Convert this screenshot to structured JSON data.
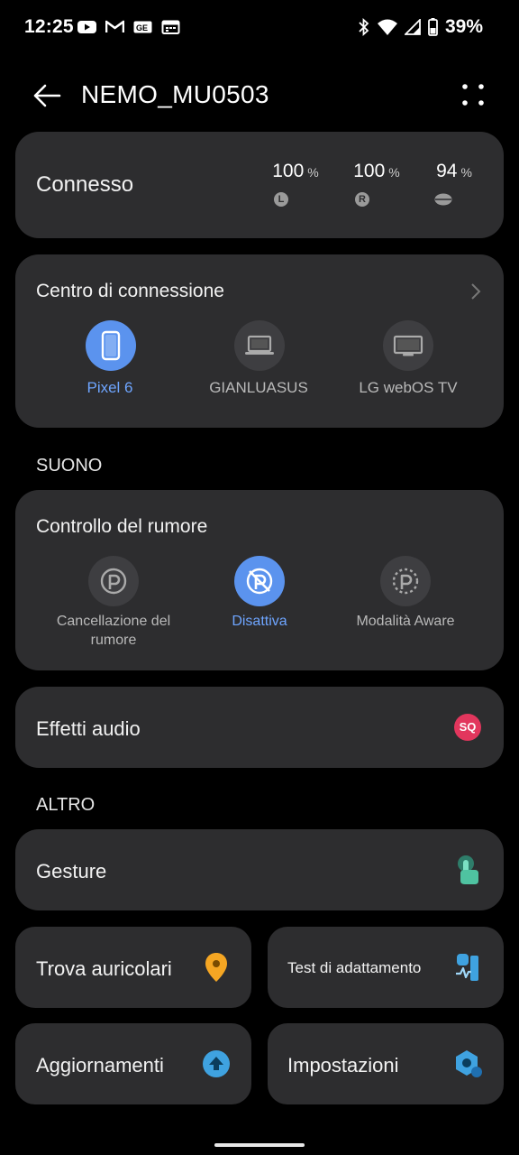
{
  "status_bar": {
    "time": "12:25",
    "battery": "39%",
    "icons": [
      "youtube-icon",
      "gmail-icon",
      "ge-icon",
      "calendar-icon",
      "bluetooth-icon",
      "wifi-icon",
      "signal-icon",
      "battery-icon"
    ]
  },
  "app_bar": {
    "title": "NEMO_MU0503"
  },
  "connection": {
    "label": "Connesso",
    "batteries": [
      {
        "value": "100",
        "unit": "%",
        "badge": "L"
      },
      {
        "value": "100",
        "unit": "%",
        "badge": "R"
      },
      {
        "value": "94",
        "unit": "%",
        "badge": ""
      }
    ]
  },
  "connection_center": {
    "title": "Centro di connessione",
    "devices": [
      {
        "name": "Pixel 6",
        "active": true
      },
      {
        "name": "GIANLUASUS",
        "active": false
      },
      {
        "name": "LG webOS TV",
        "active": false
      }
    ]
  },
  "sections": {
    "sound": "SUONO",
    "other": "ALTRO"
  },
  "noise_control": {
    "title": "Controllo del rumore",
    "modes": [
      {
        "label_line1": "Cancellazione del",
        "label_line2": "rumore",
        "active": false
      },
      {
        "label_line1": "Disattiva",
        "label_line2": "",
        "active": true
      },
      {
        "label_line1": "Modalità Aware",
        "label_line2": "",
        "active": false
      }
    ]
  },
  "audio_effects": {
    "label": "Effetti audio",
    "badge": "SQ"
  },
  "gesture": {
    "label": "Gesture"
  },
  "find_earbuds": {
    "label": "Trova auricolari"
  },
  "fit_test": {
    "label": "Test di adattamento"
  },
  "updates": {
    "label": "Aggiornamenti"
  },
  "settings": {
    "label": "Impostazioni"
  },
  "colors": {
    "accent": "#5b93ee",
    "card": "#2d2d2f",
    "sq_badge": "#e2365d",
    "find": "#f5a623",
    "gesture": "#4fc3a1",
    "settings_icon": "#3fa2e0"
  }
}
